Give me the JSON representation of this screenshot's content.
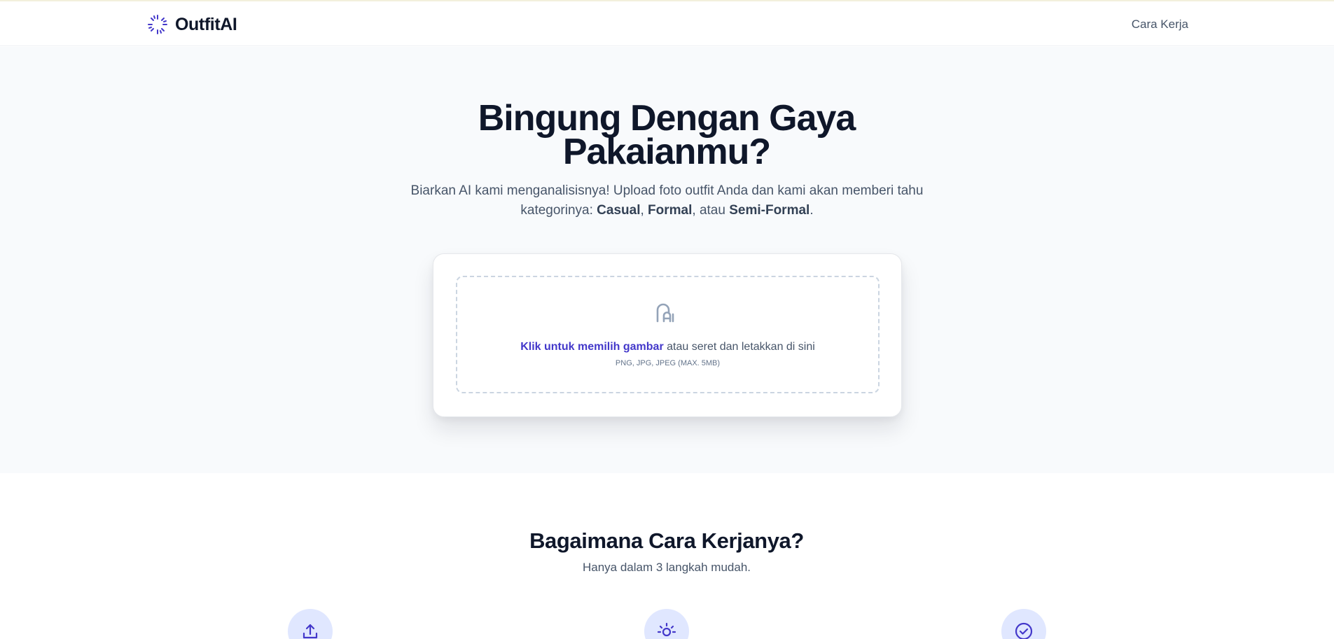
{
  "header": {
    "brand": "OutfitAI",
    "nav": {
      "how_it_works": "Cara Kerja"
    }
  },
  "hero": {
    "title": "Bingung Dengan Gaya Pakaianmu?",
    "subtitle": {
      "lead": "Biarkan AI kami menganalisisnya! Upload foto outfit Anda dan kami akan memberi tahu kategorinya: ",
      "category_1": "Casual",
      "sep_1": ", ",
      "category_2": "Formal",
      "sep_2": ", atau ",
      "category_3": "Semi-Formal",
      "end": "."
    }
  },
  "upload": {
    "icon": "upload-file-icon",
    "link_label": "Klik untuk memilih gambar",
    "text": "atau seret dan letakkan di sini",
    "hint": "PNG, JPG, JPEG (MAX. 5MB)"
  },
  "how_it_works": {
    "title": "Bagaimana Cara Kerjanya?",
    "subtitle": "Hanya dalam 3 langkah mudah.",
    "steps": [
      {
        "icon": "upload-arrow-icon"
      },
      {
        "icon": "lightbulb-icon"
      },
      {
        "icon": "check-circle-icon"
      }
    ]
  },
  "colors": {
    "accent": "#4338ca",
    "heading": "#0f172a",
    "body_text": "#475569",
    "hero_bg": "#f8fafc",
    "step_circle_bg": "#e0e7ff"
  }
}
